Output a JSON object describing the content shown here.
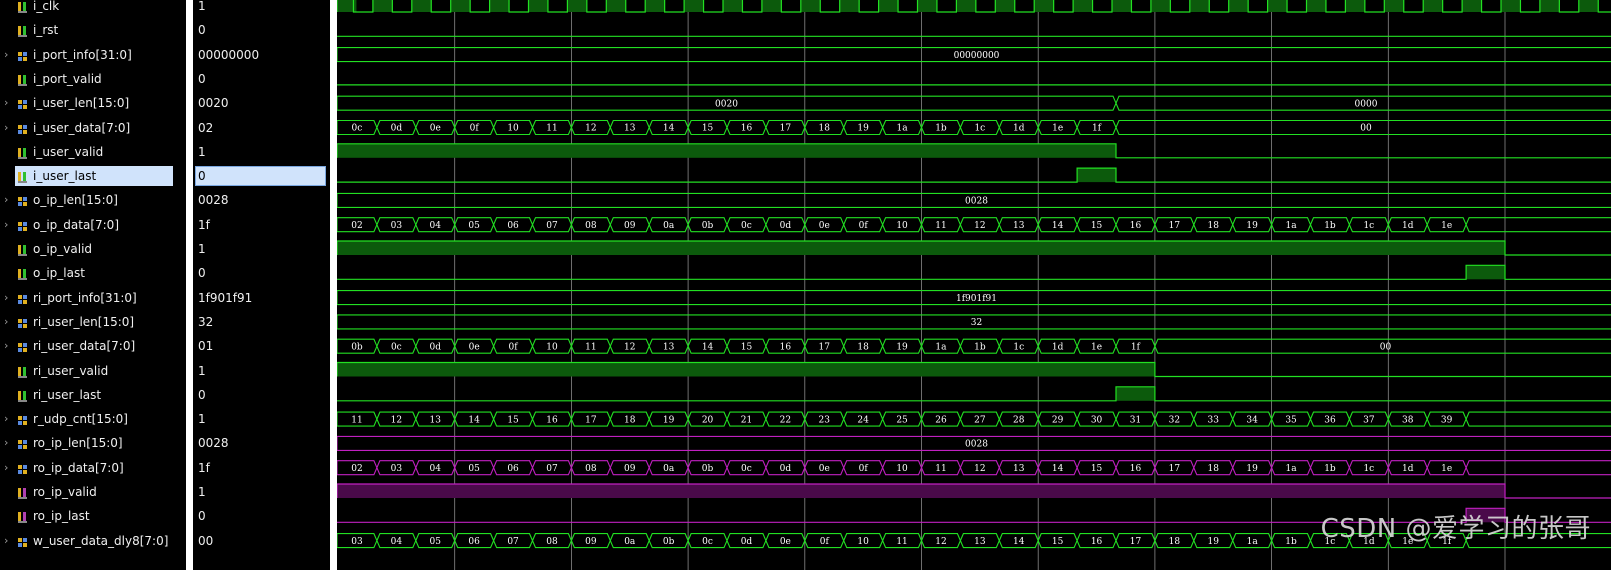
{
  "signals": [
    {
      "name": "i_clk",
      "value": "1",
      "kind": "bit",
      "expandable": false,
      "color": "green"
    },
    {
      "name": "i_rst",
      "value": "0",
      "kind": "bit",
      "expandable": false,
      "color": "green"
    },
    {
      "name": "i_port_info[31:0]",
      "value": "00000000",
      "kind": "bus",
      "expandable": true,
      "color": "green"
    },
    {
      "name": "i_port_valid",
      "value": "0",
      "kind": "bit",
      "expandable": false,
      "color": "green"
    },
    {
      "name": "i_user_len[15:0]",
      "value": "0020",
      "kind": "bus",
      "expandable": true,
      "color": "green"
    },
    {
      "name": "i_user_data[7:0]",
      "value": "02",
      "kind": "bus",
      "expandable": true,
      "color": "green"
    },
    {
      "name": "i_user_valid",
      "value": "1",
      "kind": "bit",
      "expandable": false,
      "color": "green"
    },
    {
      "name": "i_user_last",
      "value": "0",
      "kind": "bit",
      "expandable": false,
      "color": "green",
      "selected": true
    },
    {
      "name": "o_ip_len[15:0]",
      "value": "0028",
      "kind": "bus",
      "expandable": true,
      "color": "green"
    },
    {
      "name": "o_ip_data[7:0]",
      "value": "1f",
      "kind": "bus",
      "expandable": true,
      "color": "green"
    },
    {
      "name": "o_ip_valid",
      "value": "1",
      "kind": "bit",
      "expandable": false,
      "color": "green"
    },
    {
      "name": "o_ip_last",
      "value": "0",
      "kind": "bit",
      "expandable": false,
      "color": "green"
    },
    {
      "name": "ri_port_info[31:0]",
      "value": "1f901f91",
      "kind": "bus",
      "expandable": true,
      "color": "green"
    },
    {
      "name": "ri_user_len[15:0]",
      "value": "32",
      "kind": "bus",
      "expandable": true,
      "color": "green"
    },
    {
      "name": "ri_user_data[7:0]",
      "value": "01",
      "kind": "bus",
      "expandable": true,
      "color": "green"
    },
    {
      "name": "ri_user_valid",
      "value": "1",
      "kind": "bit",
      "expandable": false,
      "color": "green"
    },
    {
      "name": "ri_user_last",
      "value": "0",
      "kind": "bit",
      "expandable": false,
      "color": "green"
    },
    {
      "name": "r_udp_cnt[15:0]",
      "value": "1",
      "kind": "bus",
      "expandable": true,
      "color": "green"
    },
    {
      "name": "ro_ip_len[15:0]",
      "value": "0028",
      "kind": "bus",
      "expandable": true,
      "color": "magenta"
    },
    {
      "name": "ro_ip_data[7:0]",
      "value": "1f",
      "kind": "bus",
      "expandable": true,
      "color": "magenta"
    },
    {
      "name": "ro_ip_valid",
      "value": "1",
      "kind": "bit",
      "expandable": false,
      "color": "magenta"
    },
    {
      "name": "ro_ip_last",
      "value": "0",
      "kind": "bit",
      "expandable": false,
      "color": "magenta"
    },
    {
      "name": "w_user_data_dly8[7:0]",
      "value": "00",
      "kind": "bus",
      "expandable": true,
      "color": "green"
    }
  ],
  "waves": {
    "i_port_info": {
      "segments": [
        {
          "label": "00000000",
          "end": 32
        }
      ]
    },
    "i_user_len": {
      "segments": [
        {
          "label": "0020",
          "end": 20
        },
        {
          "label": "0000",
          "end": 32
        }
      ]
    },
    "i_user_data": {
      "segments": [
        {
          "label": "0c",
          "end": 1
        },
        {
          "label": "0d",
          "end": 2
        },
        {
          "label": "0e",
          "end": 3
        },
        {
          "label": "0f",
          "end": 4
        },
        {
          "label": "10",
          "end": 5
        },
        {
          "label": "11",
          "end": 6
        },
        {
          "label": "12",
          "end": 7
        },
        {
          "label": "13",
          "end": 8
        },
        {
          "label": "14",
          "end": 9
        },
        {
          "label": "15",
          "end": 10
        },
        {
          "label": "16",
          "end": 11
        },
        {
          "label": "17",
          "end": 12
        },
        {
          "label": "18",
          "end": 13
        },
        {
          "label": "19",
          "end": 14
        },
        {
          "label": "1a",
          "end": 15
        },
        {
          "label": "1b",
          "end": 16
        },
        {
          "label": "1c",
          "end": 17
        },
        {
          "label": "1d",
          "end": 18
        },
        {
          "label": "1e",
          "end": 19
        },
        {
          "label": "1f",
          "end": 20
        },
        {
          "label": "00",
          "end": 32
        }
      ]
    },
    "i_user_valid": {
      "high": [
        [
          0,
          20
        ]
      ]
    },
    "i_user_last": {
      "high": [
        [
          19,
          20
        ]
      ]
    },
    "o_ip_len": {
      "segments": [
        {
          "label": "0028",
          "end": 32
        }
      ]
    },
    "o_ip_data": {
      "segments": [
        {
          "label": "02",
          "end": 1
        },
        {
          "label": "03",
          "end": 2
        },
        {
          "label": "04",
          "end": 3
        },
        {
          "label": "05",
          "end": 4
        },
        {
          "label": "06",
          "end": 5
        },
        {
          "label": "07",
          "end": 6
        },
        {
          "label": "08",
          "end": 7
        },
        {
          "label": "09",
          "end": 8
        },
        {
          "label": "0a",
          "end": 9
        },
        {
          "label": "0b",
          "end": 10
        },
        {
          "label": "0c",
          "end": 11
        },
        {
          "label": "0d",
          "end": 12
        },
        {
          "label": "0e",
          "end": 13
        },
        {
          "label": "0f",
          "end": 14
        },
        {
          "label": "10",
          "end": 15
        },
        {
          "label": "11",
          "end": 16
        },
        {
          "label": "12",
          "end": 17
        },
        {
          "label": "13",
          "end": 18
        },
        {
          "label": "14",
          "end": 19
        },
        {
          "label": "15",
          "end": 20
        },
        {
          "label": "16",
          "end": 21
        },
        {
          "label": "17",
          "end": 22
        },
        {
          "label": "18",
          "end": 23
        },
        {
          "label": "19",
          "end": 24
        },
        {
          "label": "1a",
          "end": 25
        },
        {
          "label": "1b",
          "end": 26
        },
        {
          "label": "1c",
          "end": 27
        },
        {
          "label": "1d",
          "end": 28
        },
        {
          "label": "1e",
          "end": 29
        },
        {
          "label": "",
          "end": 32
        }
      ]
    },
    "o_ip_valid": {
      "high": [
        [
          0,
          30
        ]
      ]
    },
    "o_ip_last": {
      "high": [
        [
          29,
          30
        ]
      ]
    },
    "ri_port_info": {
      "segments": [
        {
          "label": "1f901f91",
          "end": 32
        }
      ]
    },
    "ri_user_len": {
      "segments": [
        {
          "label": "32",
          "end": 32
        }
      ]
    },
    "ri_user_data": {
      "segments": [
        {
          "label": "0b",
          "end": 1
        },
        {
          "label": "0c",
          "end": 2
        },
        {
          "label": "0d",
          "end": 3
        },
        {
          "label": "0e",
          "end": 4
        },
        {
          "label": "0f",
          "end": 5
        },
        {
          "label": "10",
          "end": 6
        },
        {
          "label": "11",
          "end": 7
        },
        {
          "label": "12",
          "end": 8
        },
        {
          "label": "13",
          "end": 9
        },
        {
          "label": "14",
          "end": 10
        },
        {
          "label": "15",
          "end": 11
        },
        {
          "label": "16",
          "end": 12
        },
        {
          "label": "17",
          "end": 13
        },
        {
          "label": "18",
          "end": 14
        },
        {
          "label": "19",
          "end": 15
        },
        {
          "label": "1a",
          "end": 16
        },
        {
          "label": "1b",
          "end": 17
        },
        {
          "label": "1c",
          "end": 18
        },
        {
          "label": "1d",
          "end": 19
        },
        {
          "label": "1e",
          "end": 20
        },
        {
          "label": "1f",
          "end": 21
        },
        {
          "label": "00",
          "end": 32
        }
      ]
    },
    "ri_user_valid": {
      "high": [
        [
          0,
          21
        ]
      ]
    },
    "ri_user_last": {
      "high": [
        [
          20,
          21
        ]
      ]
    },
    "r_udp_cnt": {
      "segments": [
        {
          "label": "11",
          "end": 1
        },
        {
          "label": "12",
          "end": 2
        },
        {
          "label": "13",
          "end": 3
        },
        {
          "label": "14",
          "end": 4
        },
        {
          "label": "15",
          "end": 5
        },
        {
          "label": "16",
          "end": 6
        },
        {
          "label": "17",
          "end": 7
        },
        {
          "label": "18",
          "end": 8
        },
        {
          "label": "19",
          "end": 9
        },
        {
          "label": "20",
          "end": 10
        },
        {
          "label": "21",
          "end": 11
        },
        {
          "label": "22",
          "end": 12
        },
        {
          "label": "23",
          "end": 13
        },
        {
          "label": "24",
          "end": 14
        },
        {
          "label": "25",
          "end": 15
        },
        {
          "label": "26",
          "end": 16
        },
        {
          "label": "27",
          "end": 17
        },
        {
          "label": "28",
          "end": 18
        },
        {
          "label": "29",
          "end": 19
        },
        {
          "label": "30",
          "end": 20
        },
        {
          "label": "31",
          "end": 21
        },
        {
          "label": "32",
          "end": 22
        },
        {
          "label": "33",
          "end": 23
        },
        {
          "label": "34",
          "end": 24
        },
        {
          "label": "35",
          "end": 25
        },
        {
          "label": "36",
          "end": 26
        },
        {
          "label": "37",
          "end": 27
        },
        {
          "label": "38",
          "end": 28
        },
        {
          "label": "39",
          "end": 29
        },
        {
          "label": "",
          "end": 32
        }
      ]
    },
    "ro_ip_len": {
      "segments": [
        {
          "label": "0028",
          "end": 32
        }
      ]
    },
    "ro_ip_data": {
      "segments": [
        {
          "label": "02",
          "end": 1
        },
        {
          "label": "03",
          "end": 2
        },
        {
          "label": "04",
          "end": 3
        },
        {
          "label": "05",
          "end": 4
        },
        {
          "label": "06",
          "end": 5
        },
        {
          "label": "07",
          "end": 6
        },
        {
          "label": "08",
          "end": 7
        },
        {
          "label": "09",
          "end": 8
        },
        {
          "label": "0a",
          "end": 9
        },
        {
          "label": "0b",
          "end": 10
        },
        {
          "label": "0c",
          "end": 11
        },
        {
          "label": "0d",
          "end": 12
        },
        {
          "label": "0e",
          "end": 13
        },
        {
          "label": "0f",
          "end": 14
        },
        {
          "label": "10",
          "end": 15
        },
        {
          "label": "11",
          "end": 16
        },
        {
          "label": "12",
          "end": 17
        },
        {
          "label": "13",
          "end": 18
        },
        {
          "label": "14",
          "end": 19
        },
        {
          "label": "15",
          "end": 20
        },
        {
          "label": "16",
          "end": 21
        },
        {
          "label": "17",
          "end": 22
        },
        {
          "label": "18",
          "end": 23
        },
        {
          "label": "19",
          "end": 24
        },
        {
          "label": "1a",
          "end": 25
        },
        {
          "label": "1b",
          "end": 26
        },
        {
          "label": "1c",
          "end": 27
        },
        {
          "label": "1d",
          "end": 28
        },
        {
          "label": "1e",
          "end": 29
        },
        {
          "label": "",
          "end": 32
        }
      ]
    },
    "ro_ip_valid": {
      "high": [
        [
          0,
          30
        ]
      ]
    },
    "ro_ip_last": {
      "high": [
        [
          29,
          30
        ]
      ]
    },
    "w_user_data_dly8": {
      "segments": [
        {
          "label": "03",
          "end": 1
        },
        {
          "label": "04",
          "end": 2
        },
        {
          "label": "05",
          "end": 3
        },
        {
          "label": "06",
          "end": 4
        },
        {
          "label": "07",
          "end": 5
        },
        {
          "label": "08",
          "end": 6
        },
        {
          "label": "09",
          "end": 7
        },
        {
          "label": "0a",
          "end": 8
        },
        {
          "label": "0b",
          "end": 9
        },
        {
          "label": "0c",
          "end": 10
        },
        {
          "label": "0d",
          "end": 11
        },
        {
          "label": "0e",
          "end": 12
        },
        {
          "label": "0f",
          "end": 13
        },
        {
          "label": "10",
          "end": 14
        },
        {
          "label": "11",
          "end": 15
        },
        {
          "label": "12",
          "end": 16
        },
        {
          "label": "13",
          "end": 17
        },
        {
          "label": "14",
          "end": 18
        },
        {
          "label": "15",
          "end": 19
        },
        {
          "label": "16",
          "end": 20
        },
        {
          "label": "17",
          "end": 21
        },
        {
          "label": "18",
          "end": 22
        },
        {
          "label": "19",
          "end": 23
        },
        {
          "label": "1a",
          "end": 24
        },
        {
          "label": "1b",
          "end": 25
        },
        {
          "label": "1c",
          "end": 26
        },
        {
          "label": "1d",
          "end": 27
        },
        {
          "label": "1e",
          "end": 28
        },
        {
          "label": "1f",
          "end": 29
        },
        {
          "label": "",
          "end": 32
        }
      ]
    }
  },
  "colors": {
    "green": "#22e022",
    "green_fill": "#0c5a0c",
    "magenta": "#c020c0",
    "magenta_fill": "#4a0a4a",
    "grid": "#8a8a8a",
    "selection": "#d0e3fb"
  },
  "watermark": "CSDN @爱学习的张哥"
}
